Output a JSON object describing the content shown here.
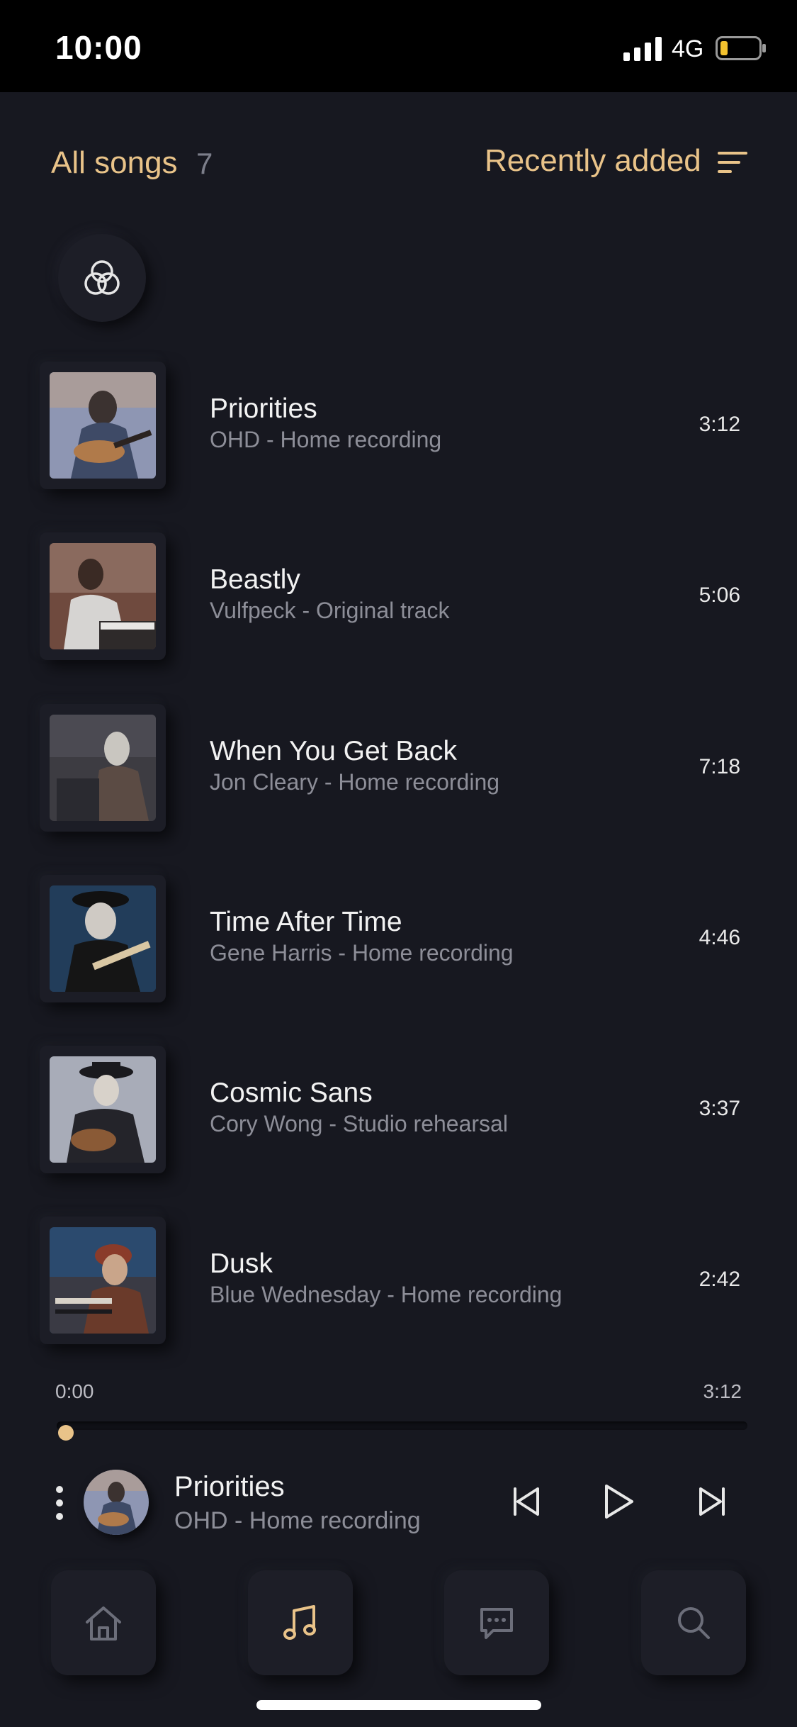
{
  "status_bar": {
    "time": "10:00",
    "network": "4G",
    "battery_level": 0.15,
    "battery_color": "#f2c12e"
  },
  "header": {
    "title": "All songs",
    "count": "7",
    "sort_label": "Recently added",
    "sort_icon": "sort-icon",
    "accent_color": "#e9c389"
  },
  "filter": {
    "icon": "venn-icon"
  },
  "songs": [
    {
      "title": "Priorities",
      "subtitle": "OHD - Home recording",
      "duration": "3:12"
    },
    {
      "title": "Beastly",
      "subtitle": "Vulfpeck - Original track",
      "duration": "5:06"
    },
    {
      "title": "When You Get Back",
      "subtitle": "Jon Cleary - Home recording",
      "duration": "7:18"
    },
    {
      "title": "Time After Time",
      "subtitle": "Gene Harris - Home recording",
      "duration": "4:46"
    },
    {
      "title": "Cosmic Sans",
      "subtitle": "Cory Wong - Studio rehearsal",
      "duration": "3:37"
    },
    {
      "title": "Dusk",
      "subtitle": "Blue Wednesday - Home recording",
      "duration": "2:42"
    }
  ],
  "player": {
    "elapsed": "0:00",
    "total": "3:12",
    "progress": 0.0,
    "title": "Priorities",
    "subtitle": "OHD - Home recording",
    "controls": [
      "previous-icon",
      "play-icon",
      "next-icon"
    ]
  },
  "nav": {
    "items": [
      "home-icon",
      "music-note-icon",
      "chat-icon",
      "search-icon"
    ],
    "active": "music-note-icon"
  }
}
